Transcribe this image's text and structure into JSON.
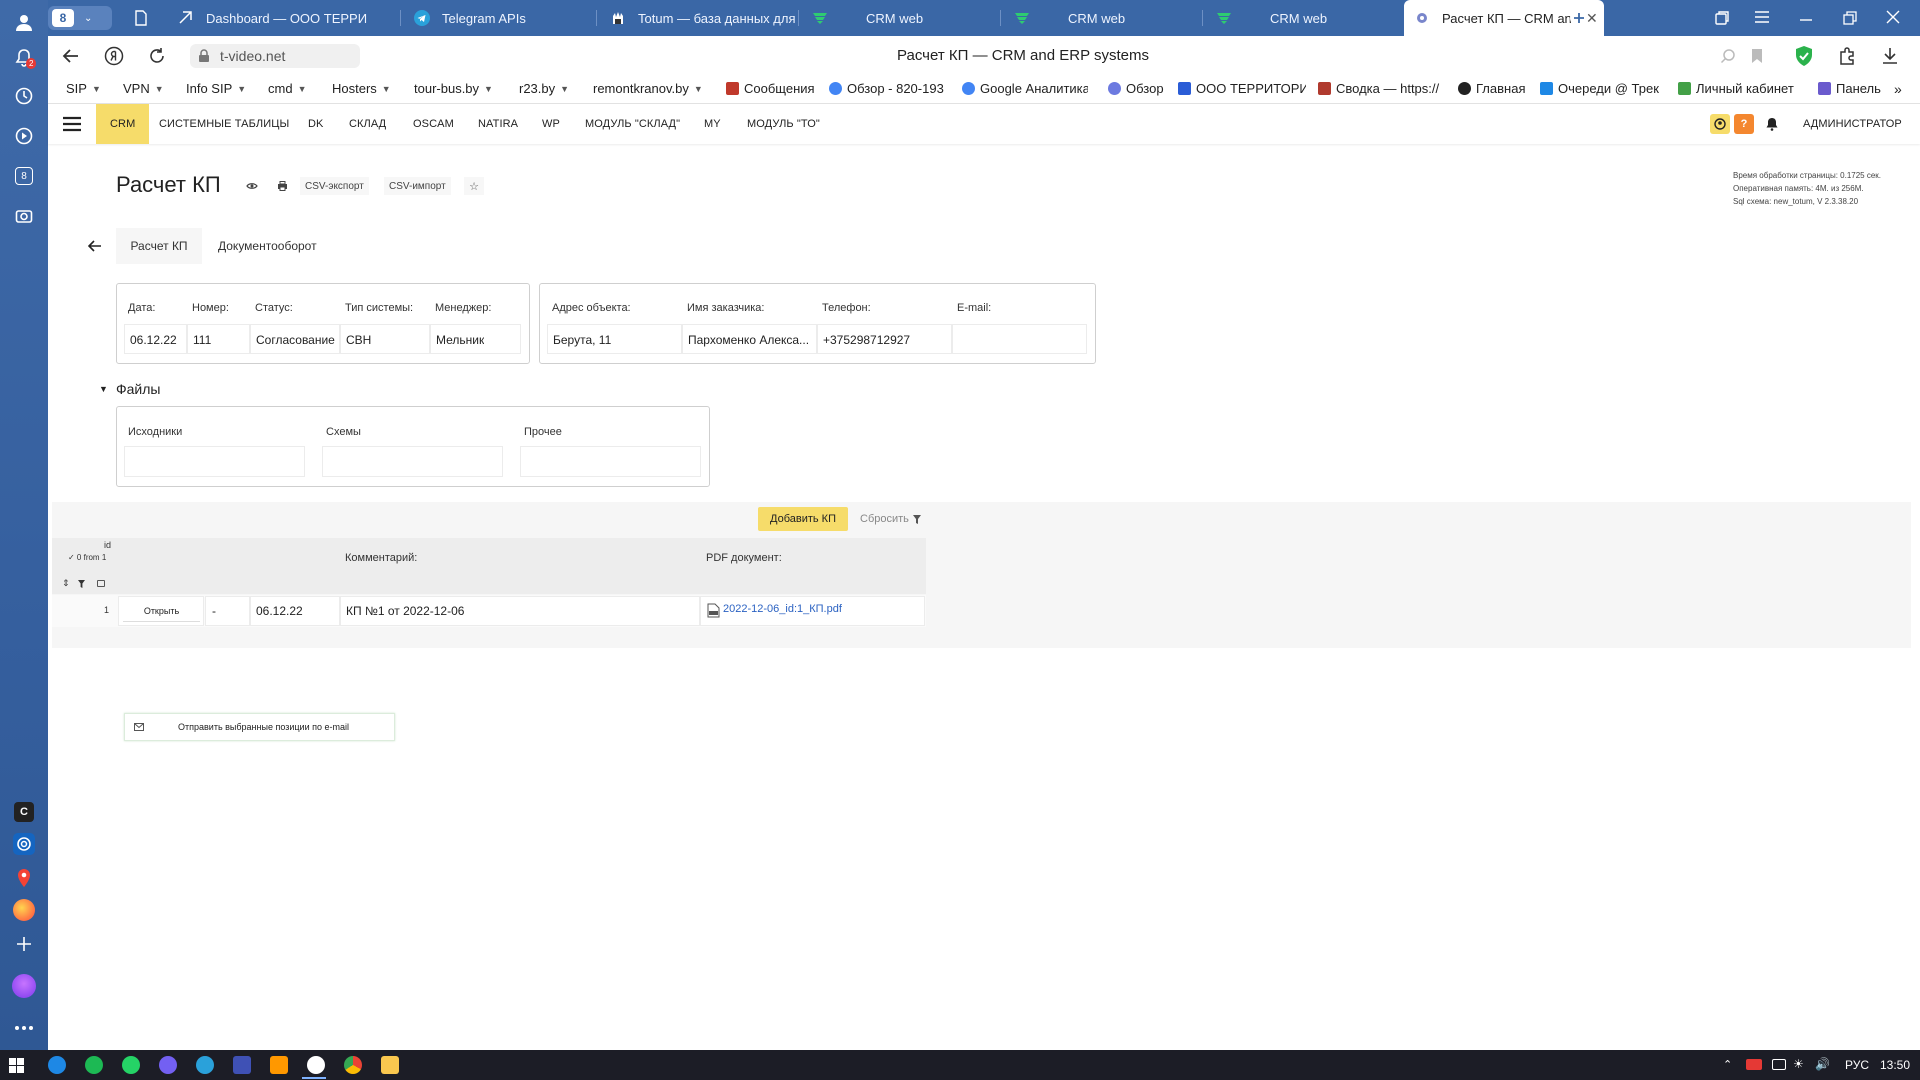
{
  "browser": {
    "tab_count": "8",
    "tabs": [
      {
        "title": "Dashboard — ООО ТЕРРИ"
      },
      {
        "title": "Telegram APIs"
      },
      {
        "title": "Totum — база данных для"
      },
      {
        "title": "CRM web"
      },
      {
        "title": "CRM web"
      },
      {
        "title": "CRM web"
      },
      {
        "title": "Расчет КП — CRM and E"
      }
    ],
    "address": "t-video.net",
    "page_title": "Расчет КП — CRM and ERP systems",
    "bookmarks": [
      {
        "label": "SIP",
        "dropdown": true
      },
      {
        "label": "VPN",
        "dropdown": true
      },
      {
        "label": "Info SIP",
        "dropdown": true
      },
      {
        "label": "cmd",
        "dropdown": true
      },
      {
        "label": "Hosters",
        "dropdown": true
      },
      {
        "label": "tour-bus.by",
        "dropdown": true
      },
      {
        "label": "r23.by",
        "dropdown": true
      },
      {
        "label": "remontkranov.by",
        "dropdown": true
      },
      {
        "label": "Сообщения",
        "icon_color": "#c0392b"
      },
      {
        "label": "Обзор - 820-193-",
        "icon_color": "#4285f4"
      },
      {
        "label": "Google Аналитика",
        "icon_color": "#4285f4"
      },
      {
        "label": "Обзор",
        "icon_color": "#6c7ae0"
      },
      {
        "label": "ООО ТЕРРИТОРИ",
        "icon_color": "#2a5cd6"
      },
      {
        "label": "Сводка — https://",
        "icon_color": "#b03a2e"
      },
      {
        "label": "Главная",
        "icon_color": "#222222"
      },
      {
        "label": "Очереди @ Трек",
        "icon_color": "#1e88e5"
      },
      {
        "label": "Личный кабинет",
        "icon_color": "#43a047"
      },
      {
        "label": "Панель",
        "icon_color": "#6a5acd"
      }
    ]
  },
  "sidebar": {
    "badge": "2",
    "tabs_count": "8",
    "c_label": "C"
  },
  "app": {
    "nav": [
      "CRM",
      "СИСТЕМНЫЕ ТАБЛИЦЫ",
      "DK",
      "СКЛАД",
      "OSCAM",
      "NATIRA",
      "WP",
      "МОДУЛЬ \"СКЛАД\"",
      "MY",
      "МОДУЛЬ \"ТО\""
    ],
    "user": "АДМИНИСТРАТОР",
    "help": "?",
    "title": "Расчет КП",
    "csv_export": "CSV-экспорт",
    "csv_import": "CSV-импорт",
    "info": [
      "Время обработки страницы: 0.1725 сек.",
      "Оперативная память: 4M. из 256M.",
      "Sql схема: new_totum, V 2.3.38.20"
    ],
    "tabs": [
      "Расчет КП",
      "Документооборот"
    ],
    "fields_left": [
      {
        "label": "Дата:",
        "value": "06.12.22"
      },
      {
        "label": "Номер:",
        "value": "111"
      },
      {
        "label": "Статус:",
        "value": "Согласование"
      },
      {
        "label": "Тип системы:",
        "value": "СВН"
      },
      {
        "label": "Менеджер:",
        "value": "Мельник"
      }
    ],
    "fields_right": [
      {
        "label": "Адрес объекта:",
        "value": "Берута, 11"
      },
      {
        "label": "Имя заказчика:",
        "value": "Пархоменко Алекса..."
      },
      {
        "label": "Телефон:",
        "value": "+375298712927"
      },
      {
        "label": "E-mail:",
        "value": ""
      }
    ],
    "files": {
      "title": "Файлы",
      "labels": [
        "Исходники",
        "Схемы",
        "Прочее"
      ]
    },
    "add_button": "Добавить КП",
    "reset": "Сбросить",
    "table": {
      "id_header": "id",
      "counter": "✓ 0 from 1",
      "comment_header": "Комментарий:",
      "pdf_header": "PDF документ:",
      "row": {
        "id": "1",
        "open": "Открыть",
        "dash": "-",
        "date": "06.12.22",
        "comment": "КП №1 от 2022-12-06",
        "pdf": "2022-12-06_id:1_КП.pdf"
      }
    },
    "send_email": "Отправить выбранные позиции по e-mail"
  },
  "taskbar": {
    "lang": "РУС",
    "time": "13:50"
  }
}
